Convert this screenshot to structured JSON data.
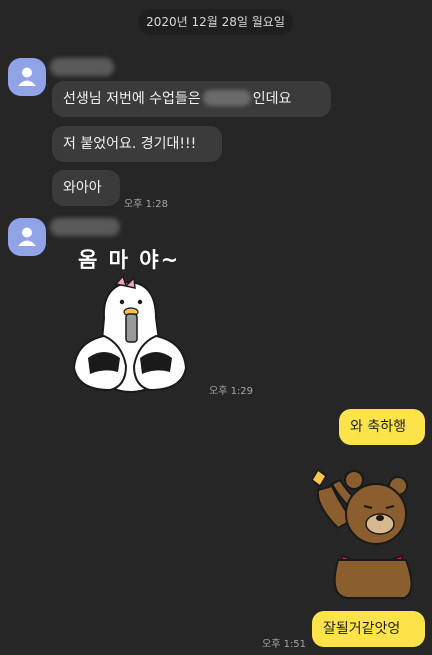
{
  "date_divider": "2020년 12월 28일 월요일",
  "messages": {
    "m1_before": "선생님 저번에 수업들은",
    "m1_after": "인데요",
    "m2": "저 붙었어요. 경기대!!!",
    "m3": "와아아",
    "m3_time": "오후 1:28",
    "sticker1_text": "옴 마 야~",
    "sticker1_time": "오후 1:29",
    "m4": "와 축하행",
    "m5": "잘될거같앗엉",
    "m5_time": "오후 1:51"
  },
  "icons": {
    "avatar": "person-icon"
  },
  "colors": {
    "background": "#262626",
    "incoming_bubble": "#3b3b3b",
    "outgoing_bubble": "#fde34a",
    "avatar": "#8fa3e6"
  }
}
